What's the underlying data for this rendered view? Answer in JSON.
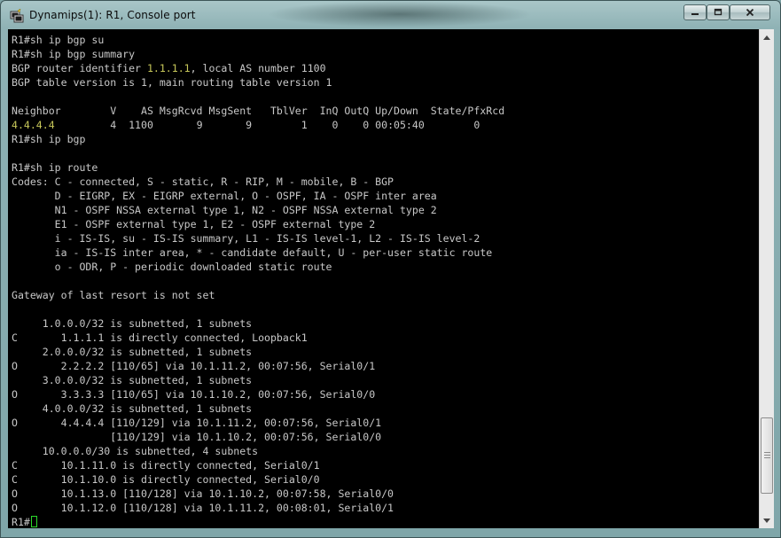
{
  "window": {
    "title": "Dynamips(1): R1, Console port",
    "icon": "putty-terminal-icon",
    "controls": {
      "minimize": "minimize-icon",
      "maximize": "maximize-icon",
      "close": "close-icon"
    }
  },
  "terminal": {
    "lines": [
      "R1#sh ip bgp su",
      "R1#sh ip bgp summary",
      "BGP router identifier 1.1.1.1, local AS number 1100",
      "BGP table version is 1, main routing table version 1",
      "",
      "Neighbor        V    AS MsgRcvd MsgSent   TblVer  InQ OutQ Up/Down  State/PfxRcd",
      "4.4.4.4         4  1100       9       9        1    0    0 00:05:40        0",
      "R1#sh ip bgp",
      "",
      "R1#sh ip route",
      "Codes: C - connected, S - static, R - RIP, M - mobile, B - BGP",
      "       D - EIGRP, EX - EIGRP external, O - OSPF, IA - OSPF inter area",
      "       N1 - OSPF NSSA external type 1, N2 - OSPF NSSA external type 2",
      "       E1 - OSPF external type 1, E2 - OSPF external type 2",
      "       i - IS-IS, su - IS-IS summary, L1 - IS-IS level-1, L2 - IS-IS level-2",
      "       ia - IS-IS inter area, * - candidate default, U - per-user static route",
      "       o - ODR, P - periodic downloaded static route",
      "",
      "Gateway of last resort is not set",
      "",
      "     1.0.0.0/32 is subnetted, 1 subnets",
      "C       1.1.1.1 is directly connected, Loopback1",
      "     2.0.0.0/32 is subnetted, 1 subnets",
      "O       2.2.2.2 [110/65] via 10.1.11.2, 00:07:56, Serial0/1",
      "     3.0.0.0/32 is subnetted, 1 subnets",
      "O       3.3.3.3 [110/65] via 10.1.10.2, 00:07:56, Serial0/0",
      "     4.0.0.0/32 is subnetted, 1 subnets",
      "O       4.4.4.4 [110/129] via 10.1.11.2, 00:07:56, Serial0/1",
      "                [110/129] via 10.1.10.2, 00:07:56, Serial0/0",
      "     10.0.0.0/30 is subnetted, 4 subnets",
      "C       10.1.11.0 is directly connected, Serial0/1",
      "C       10.1.10.0 is directly connected, Serial0/0",
      "O       10.1.13.0 [110/128] via 10.1.10.2, 00:07:58, Serial0/0",
      "O       10.1.12.0 [110/128] via 10.1.11.2, 00:08:01, Serial0/1",
      "R1#"
    ],
    "highlights": [
      "1.1.1.1",
      "4.4.4.4"
    ],
    "text_color": "#c8c8c8",
    "highlight_color": "#c8c85a",
    "cursor_color": "#2bd82b",
    "background": "#000000"
  },
  "scrollbar": {
    "position": 0.95
  }
}
